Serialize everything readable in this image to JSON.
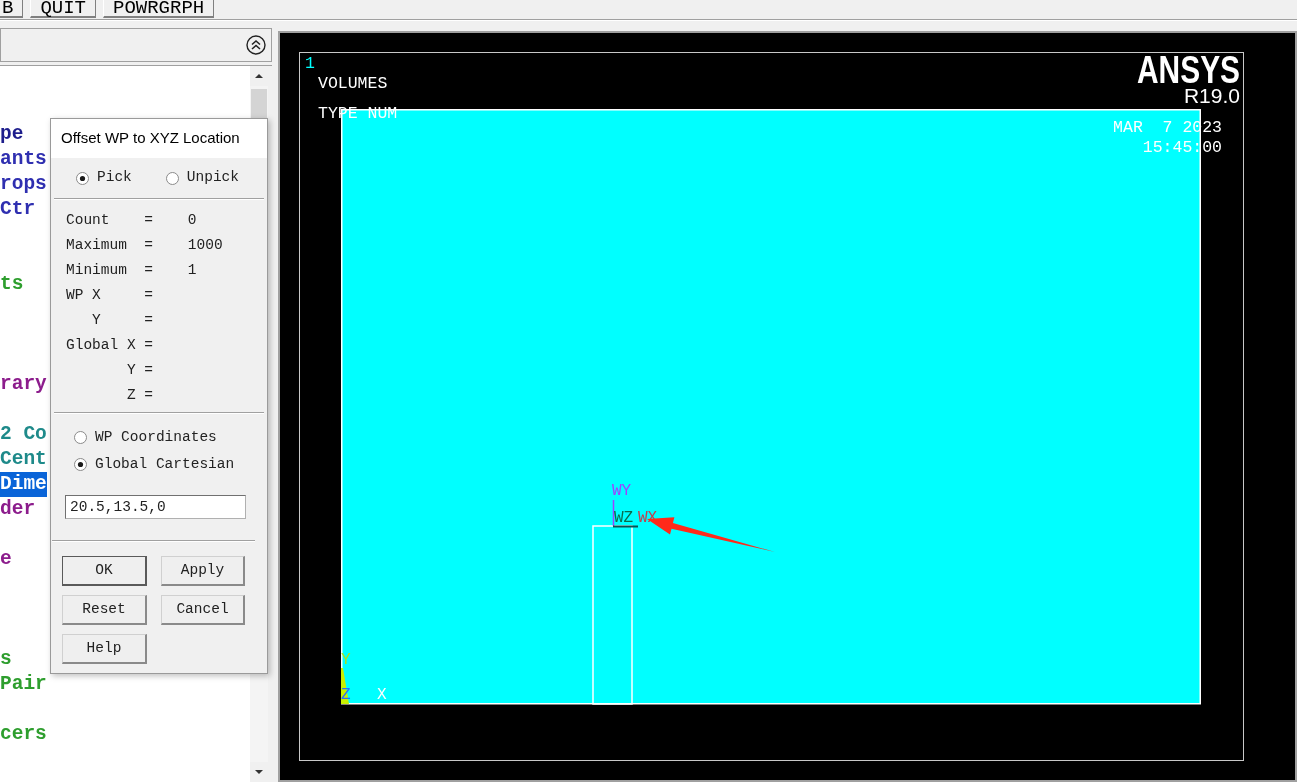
{
  "toolbar": {
    "buttons": [
      "B",
      "QUIT",
      "POWRGRPH"
    ]
  },
  "main_menu": {
    "rows": [
      {
        "kind": "covered"
      },
      {
        "kind": "covered"
      },
      {
        "kind": "item",
        "text": "pe",
        "color": "#1e1e8c",
        "selected": false
      },
      {
        "kind": "item",
        "text": "ants",
        "color": "#2f2fb0",
        "selected": false
      },
      {
        "kind": "item",
        "text": "rops",
        "color": "#2f2fb0",
        "selected": false
      },
      {
        "kind": "item",
        "text": "Ctr",
        "color": "#2f2fb0",
        "selected": false
      },
      {
        "kind": "covered"
      },
      {
        "kind": "covered"
      },
      {
        "kind": "item",
        "text": "ts",
        "color": "#2e9e2e",
        "selected": false
      },
      {
        "kind": "covered"
      },
      {
        "kind": "covered"
      },
      {
        "kind": "covered"
      },
      {
        "kind": "item",
        "text": "rary",
        "color": "#8c1c8c",
        "selected": false
      },
      {
        "kind": "covered"
      },
      {
        "kind": "item",
        "text": "2 Co",
        "color": "#1e8a8a",
        "selected": false
      },
      {
        "kind": "item",
        "text": "Cent",
        "color": "#1e8a8a",
        "selected": false
      },
      {
        "kind": "item",
        "text": "Dime",
        "selected": true
      },
      {
        "kind": "item",
        "text": "der",
        "color": "#8c1c8c",
        "selected": false
      },
      {
        "kind": "covered"
      },
      {
        "kind": "item",
        "text": "e",
        "color": "#8c1c8c",
        "selected": false
      },
      {
        "kind": "covered"
      },
      {
        "kind": "covered"
      },
      {
        "kind": "covered"
      },
      {
        "kind": "item",
        "text": "s",
        "color": "#2e9e2e",
        "selected": false
      },
      {
        "kind": "item",
        "text": "Pair",
        "color": "#2e9e2e",
        "selected": false
      },
      {
        "kind": "covered"
      },
      {
        "kind": "item",
        "text": "cers",
        "color": "#2e9e2e",
        "selected": false
      }
    ]
  },
  "offset_dialog": {
    "title": "Offset WP to XYZ Location",
    "pick_modes": [
      {
        "label": "Pick",
        "selected": true
      },
      {
        "label": "Unpick",
        "selected": false
      }
    ],
    "readouts": [
      {
        "label": "Count",
        "equals": "=",
        "value": "0"
      },
      {
        "label": "Maximum",
        "equals": "=",
        "value": "1000"
      },
      {
        "label": "Minimum",
        "equals": "=",
        "value": "1"
      }
    ],
    "wp_location": [
      {
        "label": "WP X",
        "equals": "="
      },
      {
        "label": "Y",
        "equals": "="
      }
    ],
    "global_location": [
      {
        "label": "Global X",
        "equals": "="
      },
      {
        "label": "Y",
        "equals": "="
      },
      {
        "label": "Z",
        "equals": "="
      }
    ],
    "coordinate_systems": [
      {
        "label": "WP Coordinates",
        "selected": false
      },
      {
        "label": "Global Cartesian",
        "selected": true
      }
    ],
    "location_input": {
      "value": "20.5,13.5,0"
    },
    "buttons": [
      {
        "label": "OK",
        "default": true
      },
      {
        "label": "Apply",
        "default": false
      },
      {
        "label": "Reset",
        "default": false
      },
      {
        "label": "Cancel",
        "default": false
      },
      {
        "label": "Help",
        "default": false
      }
    ]
  },
  "graphics_window": {
    "window_number": "1",
    "plot_title": "VOLUMES",
    "plot_label": "TYPE NUM",
    "logo": "ANSYS",
    "version": "R19.0",
    "date": "MAR  7 2023",
    "time": "15:45:00",
    "working_plane_triad": {
      "y_label": "WY",
      "z_label": "WZ",
      "x_label": "WX"
    },
    "global_triad": {
      "y_label": "Y",
      "z_label": "Z",
      "x_label": "X"
    }
  }
}
